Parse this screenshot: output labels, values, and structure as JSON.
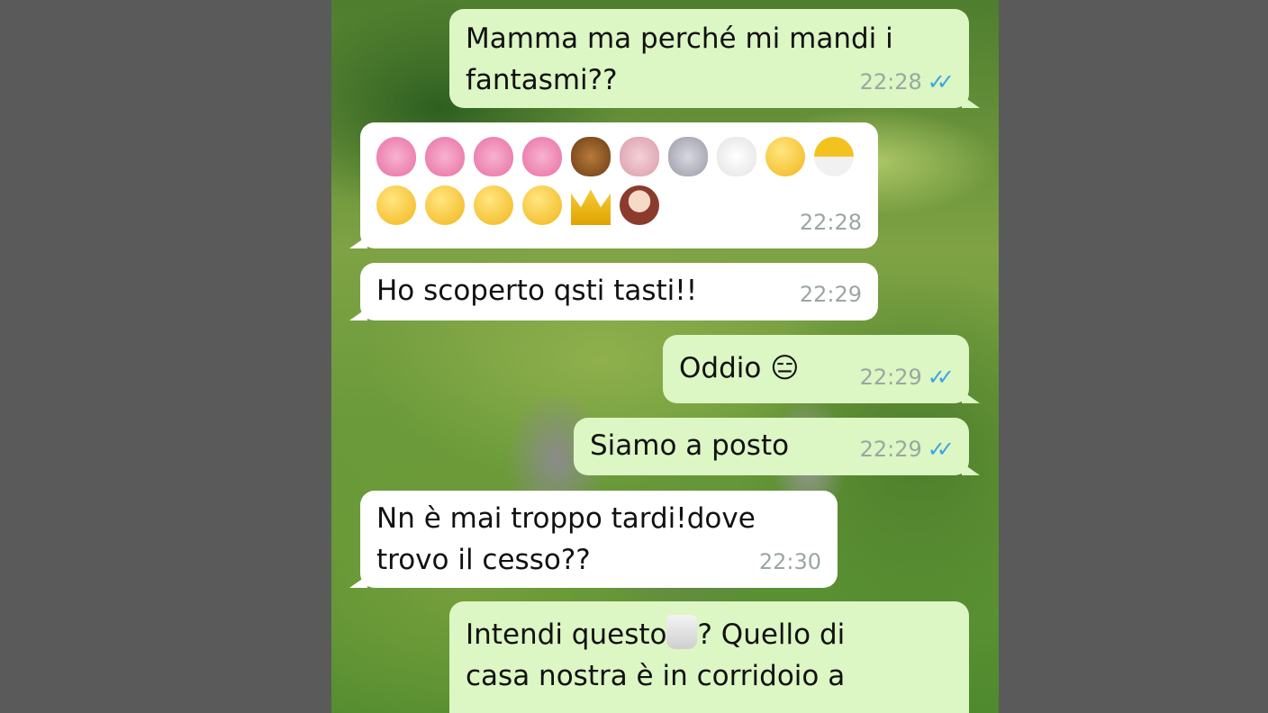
{
  "messages": [
    {
      "type": "out",
      "text": "Mamma ma perché mi mandi i\nfantasmi??",
      "time": "22:28",
      "ticks": "✓✓"
    },
    {
      "type": "in",
      "emoji_rows": [
        [
          "heart",
          "heart",
          "heart",
          "heart",
          "horse",
          "pig",
          "rabbit",
          "rabbit2",
          "chick",
          "hatching-chick"
        ],
        [
          "heart-eyes",
          "smile",
          "smile",
          "heart-eyes",
          "crown",
          "woman"
        ]
      ],
      "time": "22:28"
    },
    {
      "type": "in",
      "text": "Ho scoperto qsti tasti!!",
      "time": "22:29"
    },
    {
      "type": "out",
      "text": "Oddio 😑",
      "time": "22:29",
      "ticks": "✓✓"
    },
    {
      "type": "out",
      "text": "Siamo a posto",
      "time": "22:29",
      "ticks": "✓✓"
    },
    {
      "type": "in",
      "text": "Nn è mai troppo tardi!dove\ntrovo il cesso??",
      "time": "22:30"
    },
    {
      "type": "out",
      "text_before": "Intendi questo",
      "text_after": "? Quello di\ncasa nostra è in corridoio a"
    }
  ],
  "colors": {
    "incoming": "#ffffff",
    "outgoing": "#dcf6c4",
    "ticks": "#3ba3e3",
    "time": "#9aa7a0",
    "side_panels": "#5a5a5a"
  }
}
